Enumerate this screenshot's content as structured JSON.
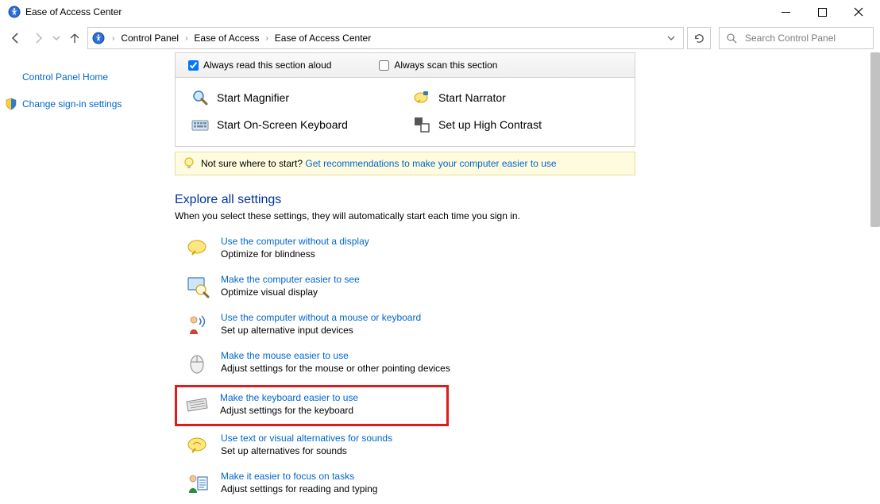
{
  "window": {
    "title": "Ease of Access Center"
  },
  "breadcrumb": {
    "items": [
      "Control Panel",
      "Ease of Access",
      "Ease of Access Center"
    ]
  },
  "search": {
    "placeholder": "Search Control Panel"
  },
  "sidebar": {
    "home": "Control Panel Home",
    "signin": "Change sign-in settings"
  },
  "quick": {
    "always_read": "Always read this section aloud",
    "always_scan": "Always scan this section",
    "magnifier": "Start Magnifier",
    "narrator": "Start Narrator",
    "osk": "Start On-Screen Keyboard",
    "contrast": "Set up High Contrast"
  },
  "tip": {
    "prefix": "Not sure where to start? ",
    "link": "Get recommendations to make your computer easier to use"
  },
  "explore": {
    "heading": "Explore all settings",
    "sub": "When you select these settings, they will automatically start each time you sign in."
  },
  "settings": [
    {
      "link": "Use the computer without a display",
      "desc": "Optimize for blindness"
    },
    {
      "link": "Make the computer easier to see",
      "desc": "Optimize visual display"
    },
    {
      "link": "Use the computer without a mouse or keyboard",
      "desc": "Set up alternative input devices"
    },
    {
      "link": "Make the mouse easier to use",
      "desc": "Adjust settings for the mouse or other pointing devices"
    },
    {
      "link": "Make the keyboard easier to use",
      "desc": "Adjust settings for the keyboard"
    },
    {
      "link": "Use text or visual alternatives for sounds",
      "desc": "Set up alternatives for sounds"
    },
    {
      "link": "Make it easier to focus on tasks",
      "desc": "Adjust settings for reading and typing"
    }
  ]
}
